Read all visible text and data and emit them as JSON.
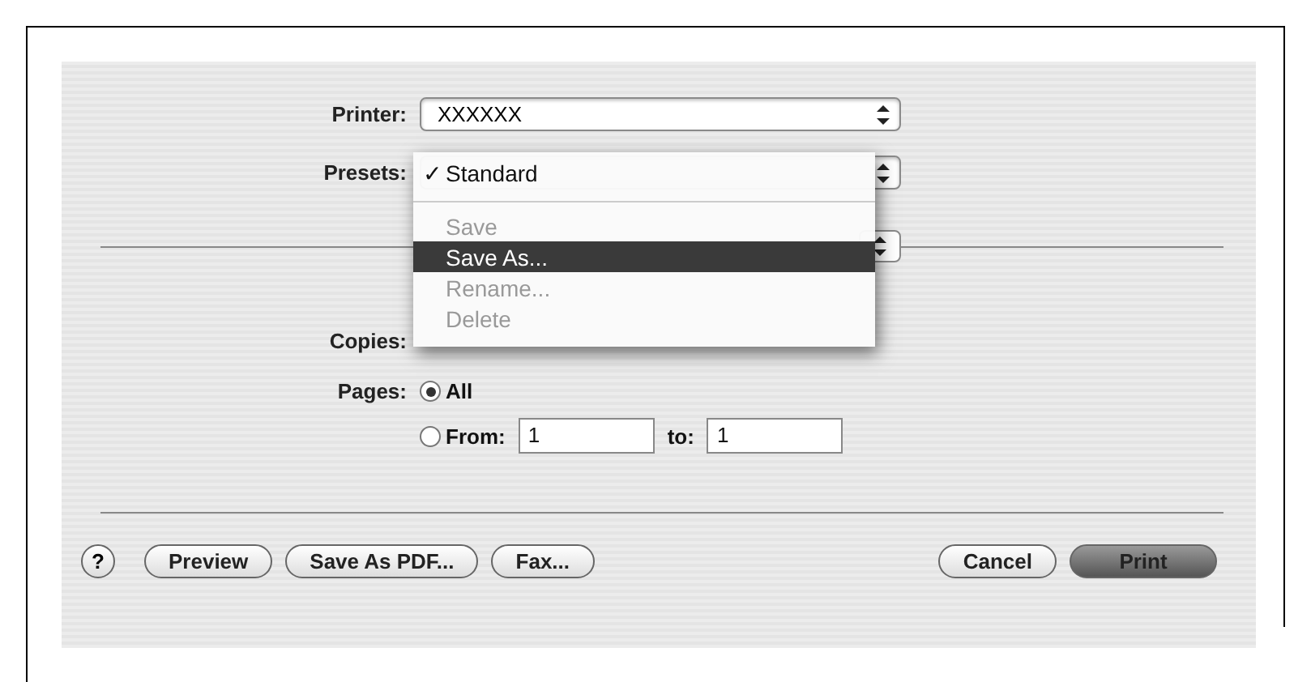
{
  "printer": {
    "label": "Printer:",
    "value": "XXXXXX"
  },
  "presets": {
    "label": "Presets:",
    "check_mark": "✓"
  },
  "presets_menu": [
    {
      "label": "Standard",
      "checked": true,
      "disabled": false,
      "selected": false
    },
    {
      "label": "Save",
      "checked": false,
      "disabled": true,
      "selected": false
    },
    {
      "label": "Save As...",
      "checked": false,
      "disabled": false,
      "selected": true
    },
    {
      "label": "Rename...",
      "checked": false,
      "disabled": true,
      "selected": false
    },
    {
      "label": "Delete",
      "checked": false,
      "disabled": true,
      "selected": false
    }
  ],
  "copies": {
    "label": "Copies:"
  },
  "pages": {
    "label": "Pages:",
    "options": [
      {
        "label": "All",
        "selected": true
      },
      {
        "label": "From:",
        "selected": false
      }
    ],
    "from": "1",
    "to_label": "to:",
    "to": "1"
  },
  "buttons": {
    "help": "?",
    "left": [
      "Preview",
      "Save As PDF...",
      "Fax..."
    ],
    "cancel": "Cancel",
    "print": "Print"
  }
}
